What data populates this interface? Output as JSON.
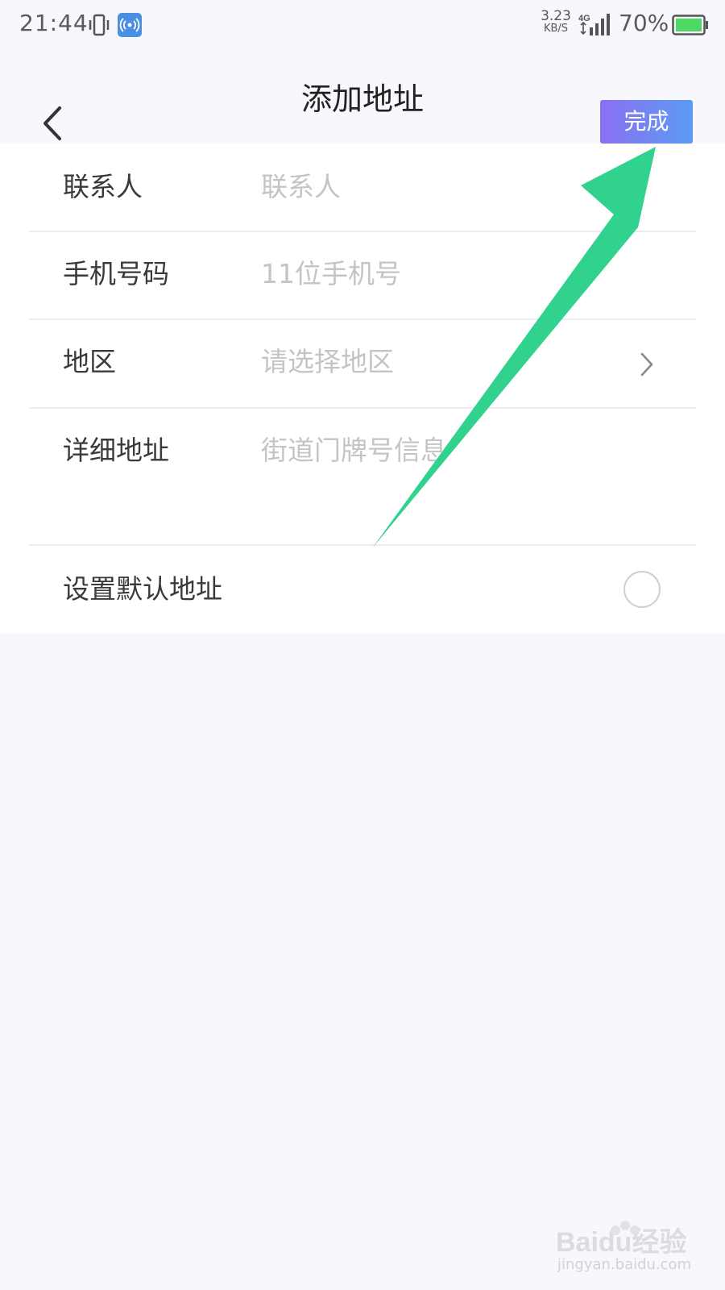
{
  "status_bar": {
    "time": "21:44",
    "net_speed_value": "3.23",
    "net_speed_unit": "KB/S",
    "network_type": "4G",
    "battery_percent": "70%"
  },
  "header": {
    "title": "添加地址",
    "done_label": "完成"
  },
  "form": {
    "contact": {
      "label": "联系人",
      "placeholder": "联系人"
    },
    "phone": {
      "label": "手机号码",
      "placeholder": "11位手机号"
    },
    "region": {
      "label": "地区",
      "placeholder": "请选择地区"
    },
    "detail": {
      "label": "详细地址",
      "placeholder": "街道门牌号信息"
    },
    "default": {
      "label": "设置默认地址",
      "checked": false
    }
  },
  "colors": {
    "done_gradient_start": "#8b6ff2",
    "done_gradient_end": "#5b9cf3",
    "arrow": "#2ad08a",
    "battery": "#4cd964"
  },
  "watermark": {
    "brand": "Baidu经验",
    "url": "jingyan.baidu.com"
  }
}
